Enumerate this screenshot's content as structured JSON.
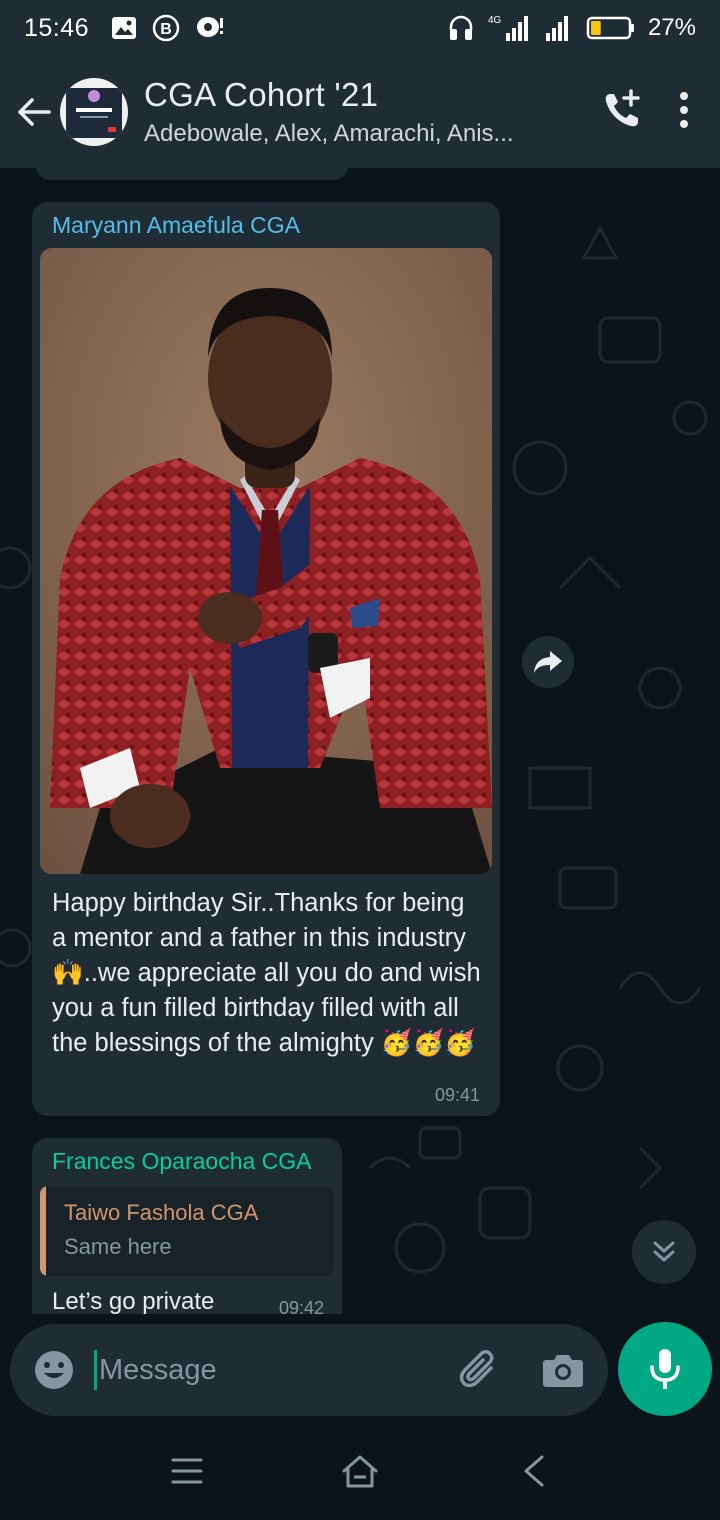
{
  "status_bar": {
    "time": "15:46",
    "network": "4G",
    "battery_percent": "27%",
    "battery_level": 0.27
  },
  "header": {
    "title": "CGA Cohort '21",
    "subtitle": "Adebowale, Alex, Amarachi, Anis..."
  },
  "messages": [
    {
      "sender": "Maryann Amaefula CGA",
      "sender_color": "#53bdeb",
      "text": "Happy birthday Sir..Thanks for being a mentor and a father in this industry 🙌..we appreciate all you do and wish you a fun filled birthday filled with all the blessings of the almighty 🥳🥳🥳",
      "time": "09:41"
    },
    {
      "sender": "Frances Oparaocha CGA",
      "sender_color": "#06cf9c",
      "quote_name": "Taiwo Fashola CGA",
      "quote_text": "Same here",
      "text": "Let’s go private",
      "time": "09:42"
    }
  ],
  "input": {
    "placeholder": "Message"
  },
  "colors": {
    "accent": "#00a884",
    "bubble": "#1f2c34",
    "background": "#0b141a"
  }
}
